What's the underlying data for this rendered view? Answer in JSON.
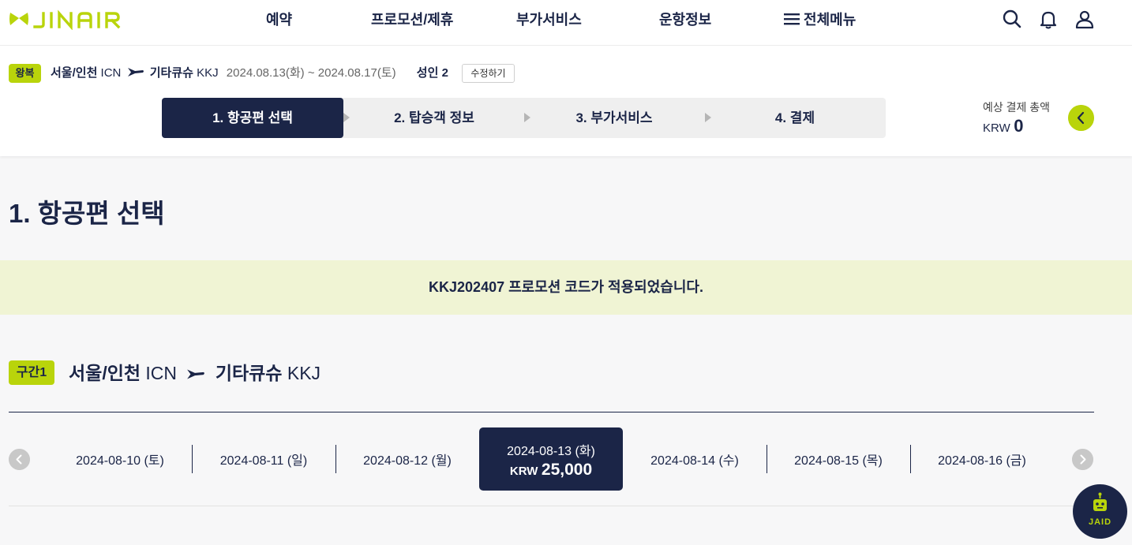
{
  "header": {
    "logo_text": "JINAIR",
    "nav": [
      "예약",
      "프로모션/제휴",
      "부가서비스",
      "운항정보"
    ],
    "all_menu_label": "전체메뉴"
  },
  "summary": {
    "trip_type": "왕복",
    "origin_city": "서울/인천",
    "origin_code": "ICN",
    "dest_city": "기타큐슈",
    "dest_code": "KKJ",
    "dates": "2024.08.13(화) ~ 2024.08.17(토)",
    "passengers": "성인 2",
    "edit_label": "수정하기"
  },
  "steps": [
    "1. 항공편 선택",
    "2. 탑승객 정보",
    "3. 부가서비스",
    "4. 결제"
  ],
  "total": {
    "label": "예상 결제 총액",
    "currency": "KRW",
    "amount": "0"
  },
  "main": {
    "title": "1. 항공편 선택",
    "promo_message": "KKJ202407 프로모션 코드가 적용되었습니다.",
    "segment_badge": "구간1",
    "segment": {
      "origin_city": "서울/인천",
      "origin_code": "ICN",
      "dest_city": "기타큐슈",
      "dest_code": "KKJ"
    }
  },
  "date_tabs": [
    {
      "date": "2024-08-10 (토)"
    },
    {
      "date": "2024-08-11 (일)"
    },
    {
      "date": "2024-08-12 (월)"
    },
    {
      "date": "2024-08-13 (화)",
      "currency": "KRW",
      "price": "25,000",
      "selected": true
    },
    {
      "date": "2024-08-14 (수)"
    },
    {
      "date": "2024-08-15 (목)"
    },
    {
      "date": "2024-08-16 (금)"
    }
  ],
  "chatbot_label": "JAID",
  "colors": {
    "brand_navy": "#1b2547",
    "brand_lime": "#b9d40b",
    "promo_bg": "#f0f4d4"
  }
}
